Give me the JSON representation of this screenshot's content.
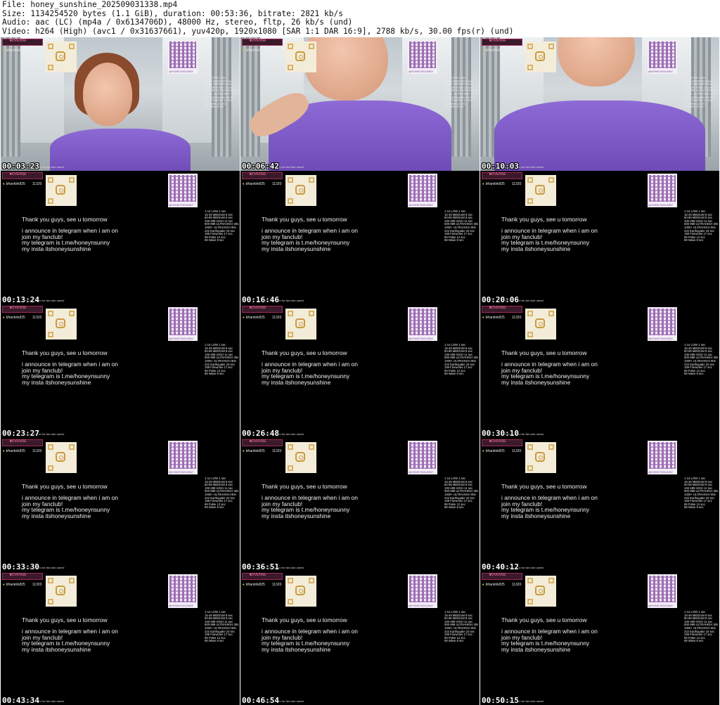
{
  "header": {
    "file": "File: honey_sunshine_202509031338.mp4",
    "size": "Size: 1134254520 bytes (1.1 GiB), duration: 00:53:36, bitrate: 2821 kb/s",
    "audio": "Audio: aac (LC) (mp4a / 0x6134706D), 48000 Hz, stereo, fltp, 26 kb/s (und)",
    "video": "Video: h264 (High) (avc1 / 0x31637661), yuv420p, 1920x1080 [SAR 1:1 DAR 16:9], 2788 kb/s, 30.00 fps(r) (und)"
  },
  "overlay": {
    "lovense_label": "LOVENSE",
    "username": "bfranklin825",
    "username_score": "11320",
    "qr_tag": "@HONEYNSUNNY",
    "tips": [
      "1-14 LOW 1 sec",
      "15-49 MEDIUM 8 sec",
      "50-99 MEDIUM 8 sec",
      "100-499 HIGH 11 sec",
      "500-999 ULTRAHIGH 30s",
      "1000+ ULTRAHIGH 90s",
      "222 Earthquake 23 sec",
      "169 Fireworks 17 sec",
      "99 Pulse 12 sec",
      "69 Wave 8 sec"
    ],
    "message_1": "Thank you guys, see u tomorrow",
    "message_2_lines": [
      "i announce in telegram when i am on",
      "join my fanclub!",
      "my telegram is t.me/honeynsunny",
      "my insta itshoneysunshine"
    ],
    "bottom_note": "lot of vids in bio for fan club users!"
  },
  "thumbnails": [
    {
      "timestamp": "00:03:23",
      "kind": "video"
    },
    {
      "timestamp": "00:06:42",
      "kind": "video"
    },
    {
      "timestamp": "00:10:03",
      "kind": "video"
    },
    {
      "timestamp": "00:13:24",
      "kind": "black"
    },
    {
      "timestamp": "00:16:46",
      "kind": "black"
    },
    {
      "timestamp": "00:20:06",
      "kind": "black"
    },
    {
      "timestamp": "00:23:27",
      "kind": "black"
    },
    {
      "timestamp": "00:26:48",
      "kind": "black"
    },
    {
      "timestamp": "00:30:10",
      "kind": "black"
    },
    {
      "timestamp": "00:33:30",
      "kind": "black"
    },
    {
      "timestamp": "00:36:51",
      "kind": "black"
    },
    {
      "timestamp": "00:40:12",
      "kind": "black"
    },
    {
      "timestamp": "00:43:34",
      "kind": "black"
    },
    {
      "timestamp": "00:46:54",
      "kind": "black"
    },
    {
      "timestamp": "00:50:15",
      "kind": "black"
    }
  ]
}
